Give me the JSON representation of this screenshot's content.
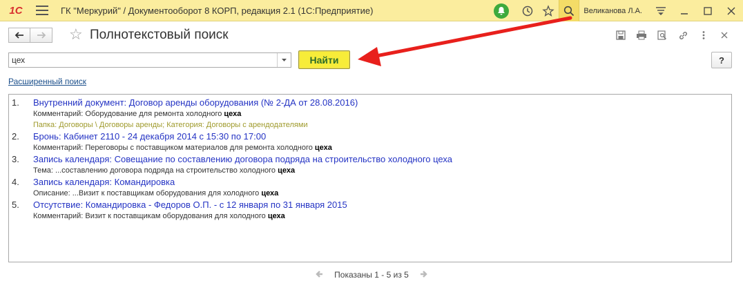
{
  "titlebar": {
    "logo": "1С",
    "title": "ГК \"Меркурий\" / Документооборот 8 КОРП, редакция 2.1  (1С:Предприятие)",
    "user": "Великанова Л.А.",
    "icons": [
      "bell-icon",
      "history-icon",
      "star-icon",
      "search-icon",
      "filter-icon",
      "minimize-icon",
      "maximize-icon",
      "close-icon"
    ]
  },
  "form": {
    "title": "Полнотекстовый поиск",
    "icons": [
      "save-icon",
      "print-icon",
      "preview-icon",
      "link-icon",
      "more-icon",
      "close-icon"
    ]
  },
  "search": {
    "value": "цех",
    "find_label": "Найти",
    "help_label": "?"
  },
  "advanced_link": "Расширенный поиск",
  "results": [
    {
      "num": "1.",
      "title": "Внутренний документ: Договор аренды оборудования (№ 2-ДА от 28.08.2016)",
      "lines": [
        {
          "prefix": "Комментарий: Оборудование для ремонта холодного ",
          "match": "цеха",
          "type": "normal"
        },
        {
          "prefix": "Папка: Договоры \\ Договоры аренды; Категория: Договоры с арендодателями",
          "match": "",
          "type": "folder"
        }
      ]
    },
    {
      "num": "2.",
      "title": "Бронь: Кабинет 2110 - 24 декабря 2014 с 15:30 по 17:00",
      "lines": [
        {
          "prefix": "Комментарий: Переговоры с поставщиком материалов для ремонта холодного ",
          "match": "цеха",
          "type": "normal"
        }
      ]
    },
    {
      "num": "3.",
      "title": "Запись календаря: Совещание по составлению договора подряда на строительство холодного цеха",
      "lines": [
        {
          "prefix": "Тема: ...составлению договора подряда на строительство холодного ",
          "match": "цеха",
          "type": "normal"
        }
      ]
    },
    {
      "num": "4.",
      "title": "Запись календаря: Командировка",
      "lines": [
        {
          "prefix": "Описание: ...Визит к поставщикам оборудования для холодного ",
          "match": "цеха",
          "type": "normal"
        }
      ]
    },
    {
      "num": "5.",
      "title": "Отсутствие: Командировка - Федоров О.П. - с 12 января по 31 января 2015",
      "lines": [
        {
          "prefix": "Комментарий: Визит к поставщикам оборудования для холодного ",
          "match": "цеха",
          "type": "normal"
        }
      ]
    }
  ],
  "pager": {
    "text": "Показаны 1 - 5 из 5"
  },
  "colors": {
    "titlebar_bg": "#fbed9e",
    "find_button_bg": "#f7ec39",
    "link_blue": "#2433c4",
    "folder_text": "#9f9a2c",
    "annotation_arrow": "#e8201c"
  }
}
